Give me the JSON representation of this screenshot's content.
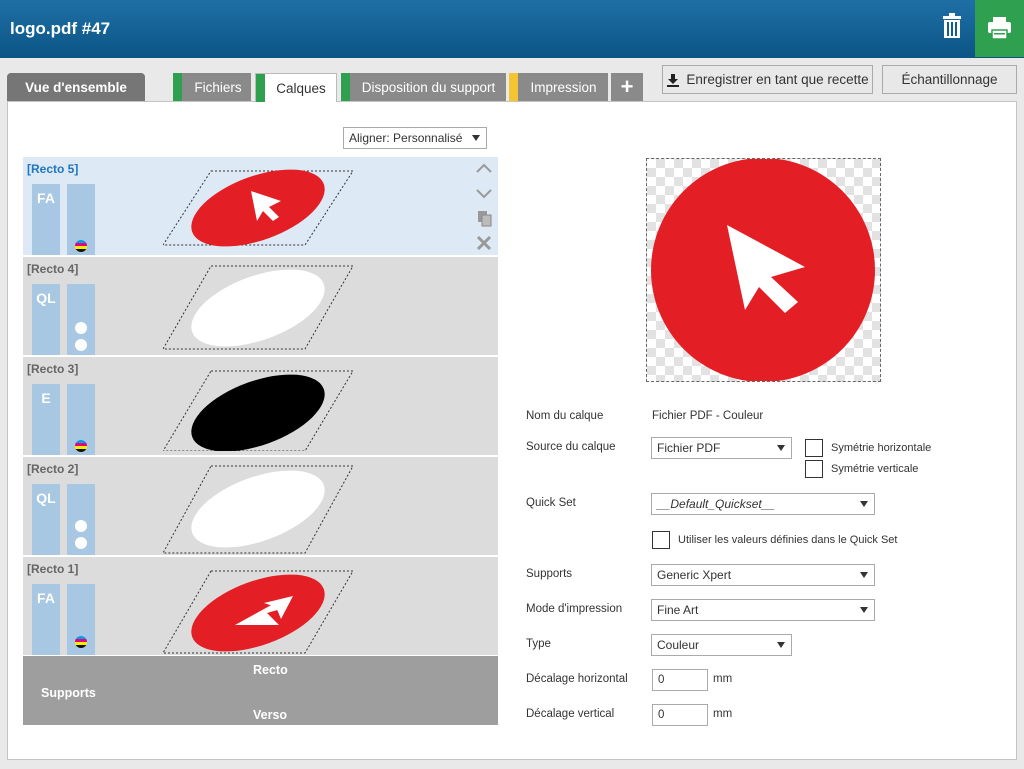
{
  "window": {
    "title": "logo.pdf #47"
  },
  "tabs": {
    "overview": "Vue d'ensemble",
    "files": "Fichiers",
    "layers": "Calques",
    "layout": "Disposition du support",
    "print": "Impression",
    "add": "+"
  },
  "tab_status_colors": {
    "files": "#2ea04f",
    "layers": "#2ea04f",
    "layout": "#2ea04f",
    "print": "#f4c531"
  },
  "toolbar": {
    "save_recipe": "Enregistrer en tant que recette",
    "sampling": "Échantillonnage"
  },
  "align": {
    "label": "Aligner: Personnalisé"
  },
  "layers": [
    {
      "name": "[Recto 5]",
      "badge": "FA",
      "indicator": "cmyk-icon",
      "shape_color": "#e31e24",
      "arrow": true,
      "selected": true
    },
    {
      "name": "[Recto 4]",
      "badge": "QL",
      "indicator": "white-dots-icon",
      "shape_color": "#ffffff",
      "arrow": false,
      "selected": false
    },
    {
      "name": "[Recto 3]",
      "badge": "E",
      "indicator": "cmyk-icon",
      "shape_color": "#000000",
      "arrow": false,
      "selected": false
    },
    {
      "name": "[Recto 2]",
      "badge": "QL",
      "indicator": "white-dots-icon",
      "shape_color": "#ffffff",
      "arrow": false,
      "selected": false
    },
    {
      "name": "[Recto 1]",
      "badge": "FA",
      "indicator": "cmyk-icon",
      "shape_color": "#e31e24",
      "arrow": true,
      "selected": false
    }
  ],
  "supports": {
    "label": "Supports",
    "recto": "Recto",
    "verso": "Verso"
  },
  "properties": {
    "layer_name_label": "Nom du calque",
    "layer_name_value": "Fichier PDF - Couleur",
    "source_label": "Source du calque",
    "source_value": "Fichier PDF",
    "mirror_h": "Symétrie horizontale",
    "mirror_v": "Symétrie verticale",
    "quickset_label": "Quick Set",
    "quickset_value": "__Default_Quickset__",
    "use_quickset": "Utiliser les valeurs définies dans le Quick Set",
    "media_label": "Supports",
    "media_value": "Generic Xpert",
    "mode_label": "Mode d'impression",
    "mode_value": "Fine Art",
    "type_label": "Type",
    "type_value": "Couleur",
    "offset_h_label": "Décalage horizontal",
    "offset_h_value": "0",
    "offset_v_label": "Décalage vertical",
    "offset_v_value": "0",
    "unit": "mm"
  },
  "colors": {
    "brand_red": "#e31e24",
    "titlebar": "#0b5585",
    "print_green": "#2ea04f",
    "selected_layer": "#dde9f5"
  }
}
